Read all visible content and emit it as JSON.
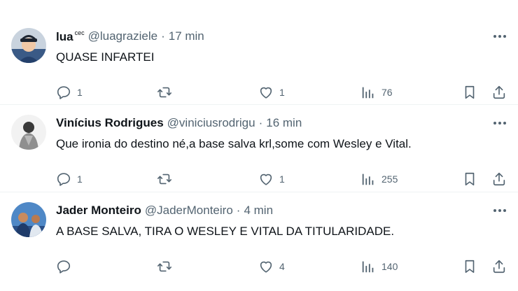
{
  "colors": {
    "text": "#0f1419",
    "secondary": "#536471",
    "divider": "#eff3f4"
  },
  "posts": [
    {
      "name": "lua",
      "name_sup": "cec",
      "handle": "@luagraziele",
      "separator": "·",
      "time": "17 min",
      "text": "QUASE INFARTEI",
      "replies": "1",
      "reposts": "",
      "likes": "1",
      "views": "76"
    },
    {
      "name": "Vinícius Rodrigues",
      "handle": "@viniciusrodrigu",
      "separator": "·",
      "time": "16 min",
      "text": "Que ironia do destino né,a base salva krl,some com Wesley e Vital.",
      "replies": "1",
      "reposts": "",
      "likes": "1",
      "views": "255"
    },
    {
      "name": "Jader Monteiro",
      "handle": "@JaderMonteiro",
      "separator": "·",
      "time": "4 min",
      "text": "A BASE SALVA, TIRA O WESLEY E VITAL DA TITULARIDADE.",
      "replies": "",
      "reposts": "",
      "likes": "4",
      "views": "140"
    }
  ]
}
